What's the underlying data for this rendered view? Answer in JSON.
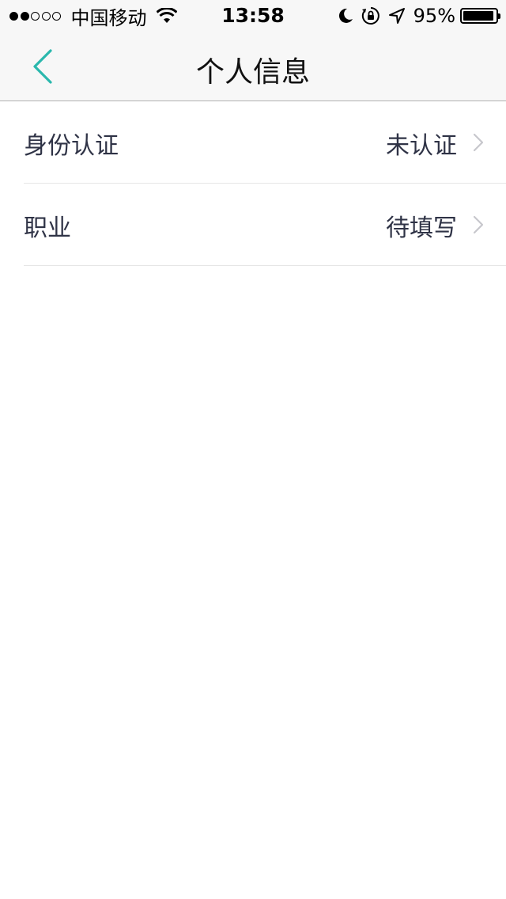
{
  "status_bar": {
    "signal_dots": [
      true,
      true,
      false,
      false,
      false
    ],
    "carrier": "中国移动",
    "time": "13:58",
    "battery_percent": "95%",
    "battery_level": 0.95,
    "icons": [
      "wifi-icon",
      "moon-icon",
      "orientation-lock-icon",
      "location-arrow-icon",
      "battery-icon"
    ]
  },
  "nav": {
    "title": "个人信息",
    "back_icon": "chevron-left-icon",
    "accent_color": "#2ab8ad"
  },
  "rows": [
    {
      "label": "身份认证",
      "value": "未认证"
    },
    {
      "label": "职业",
      "value": "待填写"
    }
  ]
}
